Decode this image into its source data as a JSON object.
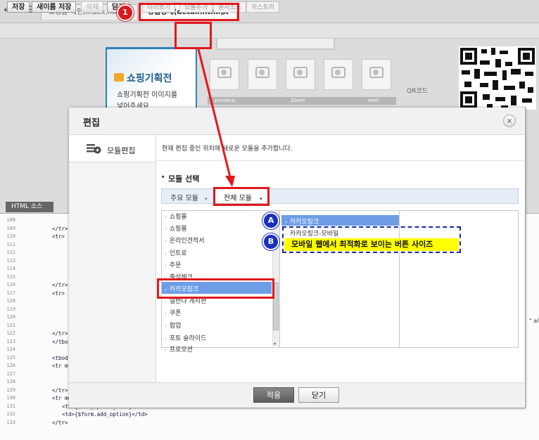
{
  "tabs": [
    {
      "label": "쇼핑몰 메인(index.html)"
    },
    {
      "label": "상품상세(detail.html)",
      "close": "×"
    }
  ],
  "toolbar": {
    "save": "저장",
    "save_as": "새이름 저장",
    "delete": "삭제",
    "close": "닫기",
    "preview": "미리보기",
    "add_module": "모듈추가",
    "source_view": "원시소스",
    "history": "히스토리"
  },
  "preview": {
    "banner_title": "쇼핑기획전",
    "banner_text_1": "쇼핑기획전 이미지를",
    "banner_text_2": "넣어주세요",
    "thumb_prev": "previous",
    "thumb_zoom": "Zoom",
    "thumb_next": "next",
    "qrcode_label": "QR코드"
  },
  "code_tab": "HTML 소스",
  "code_lines": [
    {
      "n": "108",
      "t": ""
    },
    {
      "n": "109",
      "t": "</tr>"
    },
    {
      "n": "110",
      "t": "<tr>"
    },
    {
      "n": "111",
      "t": ""
    },
    {
      "n": "112",
      "t": ""
    },
    {
      "n": "113",
      "t": ""
    },
    {
      "n": "114",
      "t": ""
    },
    {
      "n": "115",
      "t": ""
    },
    {
      "n": "116",
      "t": "</tr>"
    },
    {
      "n": "117",
      "t": "<tr>"
    },
    {
      "n": "118",
      "t": ""
    },
    {
      "n": "119",
      "t": ""
    },
    {
      "n": "120",
      "t": ""
    },
    {
      "n": "121",
      "t": ""
    },
    {
      "n": "122",
      "t": "</tr>"
    },
    {
      "n": "123",
      "t": "</tbo"
    },
    {
      "n": "124",
      "t": ""
    },
    {
      "n": "125",
      "t": "<tbod"
    },
    {
      "n": "126",
      "t": "<tr m"
    },
    {
      "n": "127",
      "t": ""
    },
    {
      "n": "128",
      "t": ""
    },
    {
      "n": "129",
      "t": "</tr>"
    },
    {
      "n": "130",
      "t": "<tr module=\"product_addoption\">"
    },
    {
      "n": "131",
      "t": "<th>{$add_option_name}</th>"
    },
    {
      "n": "132",
      "t": "<td>{$form.add_option}</td>"
    },
    {
      "n": "133",
      "t": "</tr>"
    }
  ],
  "modal": {
    "title": "편집",
    "close_icon": "×",
    "sidebar_item": "모듈편집",
    "description": "현재 편집 중인 위치에 새로운 모듈을 추가합니다.",
    "select_title": "모듈 선택",
    "tab_main": "주요 모듈",
    "tab_all": "전체 모듈",
    "apply": "적용",
    "close": "닫기"
  },
  "module_list": [
    "쇼핑몰",
    "쇼핑몰",
    "온라인견적서",
    "인트로",
    "주문",
    "출석체크",
    "카카오링크",
    "일반나 게시판",
    "쿠폰",
    "팝업",
    "포토 슬라이드",
    "프로모션"
  ],
  "sub_list": [
    "카카오링크",
    "카카오링크-모바일"
  ],
  "annotation": {
    "badge_1": "1",
    "badge_a": "A",
    "badge_b": "B",
    "note_b": "모바일 웹에서 최적화로 보이는 버튼 사이즈"
  },
  "colors": {
    "annotation_red": "#e2171d",
    "annotation_blue": "#1b2fbd",
    "selection_blue": "#6e9de6",
    "highlight_yellow": "#ffff00"
  }
}
